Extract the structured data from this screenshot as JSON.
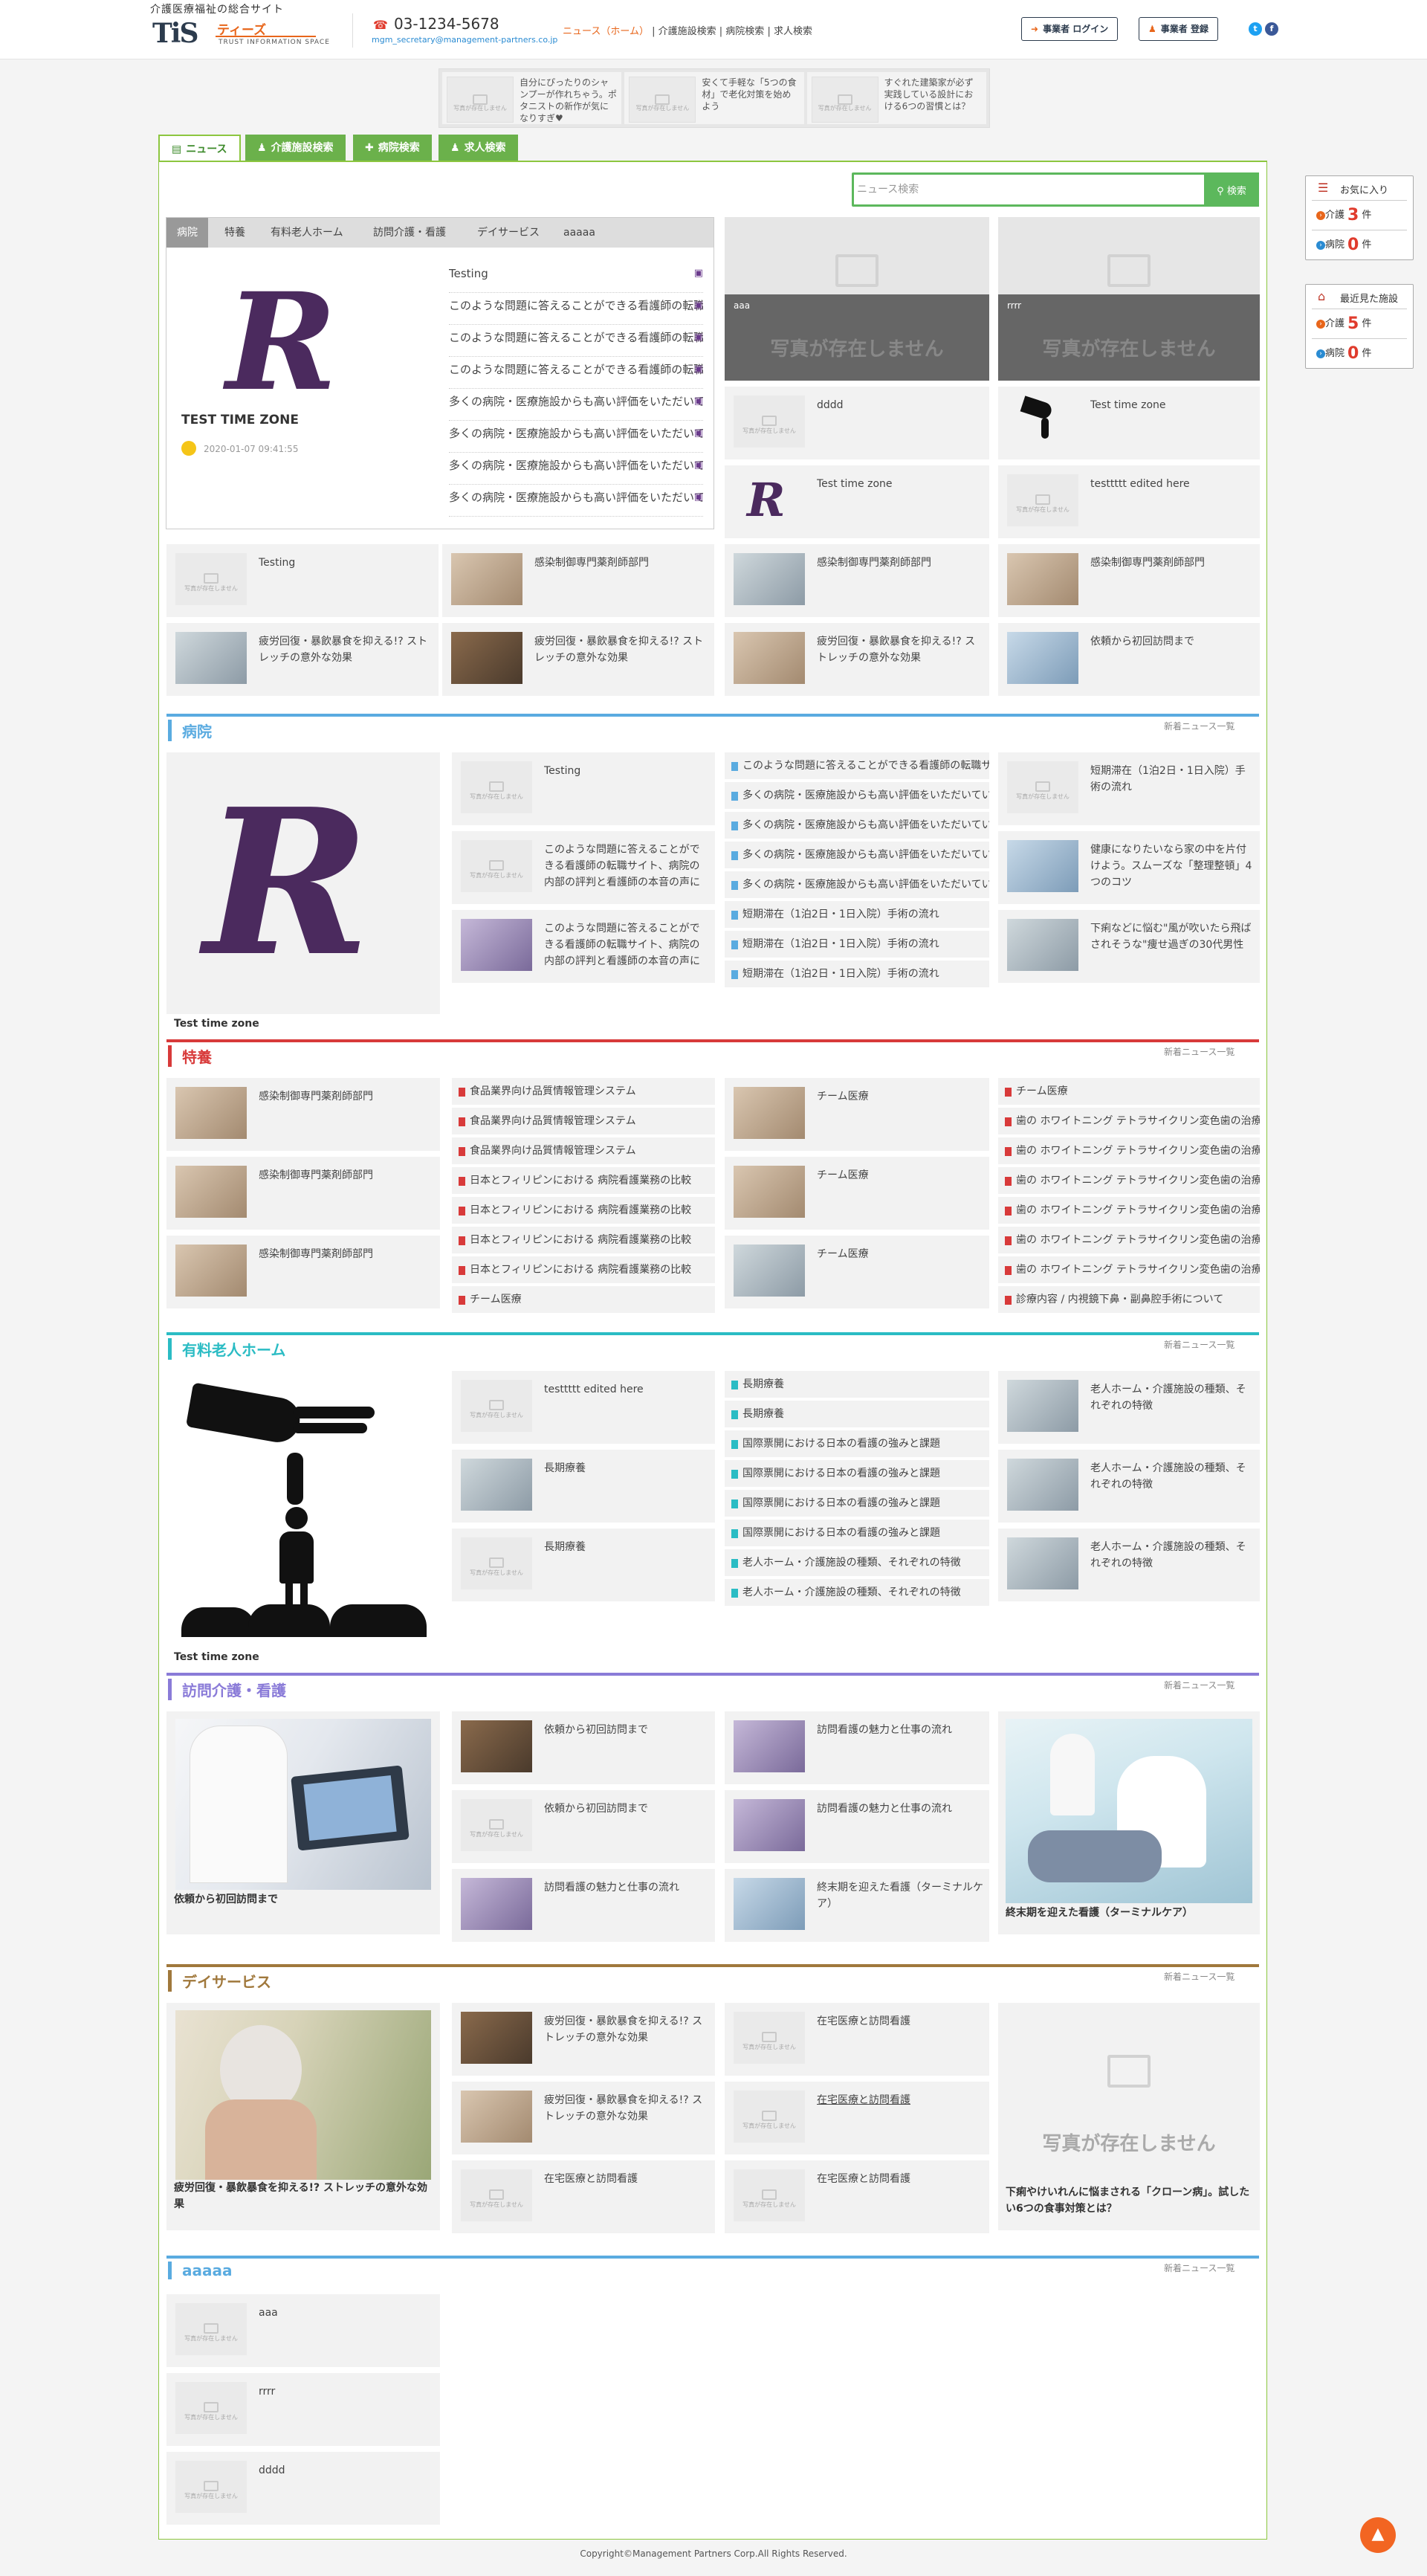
{
  "header": {
    "tagline": "介護医療福祉の総合サイト",
    "logo_mark": "TiS",
    "logo_name": "ティーズ",
    "logo_sub": "TRUST INFORMATION SPACE",
    "phone": "03-1234-5678",
    "email": "mgm_secretary@management-partners.co.jp",
    "nav": [
      "ニュース（ホーム）",
      "介護施設検索",
      "病院検索",
      "求人検索"
    ],
    "login_button": "事業者 ログイン",
    "register_button": "事業者 登録",
    "social": [
      "twitter-icon",
      "facebook-icon"
    ]
  },
  "ads": [
    {
      "text": "自分にぴったりのシャンプーが作れちゃう。ポタニストの新作が気になりすぎ♥"
    },
    {
      "text": "安くて手軽な「5つの食材」で老化対策を始めよう"
    },
    {
      "text": "すぐれた建築家が必ず実践している設計における6つの習慣とは？"
    }
  ],
  "placeholder_caption": "写真が存在しません",
  "tabs": [
    "ニュース",
    "介護施設検索",
    "病院検索",
    "求人検索"
  ],
  "search": {
    "placeholder": "ニュース検索",
    "button": "検索"
  },
  "side": {
    "favorites": {
      "title": "お気に入り",
      "rows": [
        {
          "label": "介護",
          "count": "3",
          "unit": "件"
        },
        {
          "label": "病院",
          "count": "0",
          "unit": "件"
        }
      ]
    },
    "recent": {
      "title": "最近見た施設",
      "rows": [
        {
          "label": "介護",
          "count": "5",
          "unit": "件"
        },
        {
          "label": "病院",
          "count": "0",
          "unit": "件"
        }
      ]
    }
  },
  "feature": {
    "tabs": [
      "病院",
      "特養",
      "有料老人ホーム",
      "訪問介護・看護",
      "デイサービス",
      "aaaaa"
    ],
    "logo": "R",
    "title": "TEST TIME ZONE",
    "date": "2020-01-07 09:41:55",
    "list": [
      "Testing",
      "このような問題に答えることができる看護師の転職サイト",
      "このような問題に答えることができる看護師の転職サイト",
      "このような問題に答えることができる看護師の転職サイト",
      "多くの病院・医療施設からも高い評価をいただいています",
      "多くの病院・医療施設からも高い評価をいただいています",
      "多くの病院・医療施設からも高い評価をいただいています",
      "多くの病院・医療施設からも高い評価をいただいています"
    ]
  },
  "top_right": {
    "big": [
      {
        "label": "aaa",
        "nophoto": "写真が存在しません"
      },
      {
        "label": "rrrr",
        "nophoto": "写真が存在しません"
      }
    ],
    "cards": [
      "dddd",
      "Test time zone",
      "Test time zone",
      "testtttt edited here"
    ]
  },
  "top_grid": [
    "Testing",
    "感染制御専門薬剤師部門",
    "感染制御専門薬剤師部門",
    "感染制御専門薬剤師部門",
    "疲労回復・暴飲暴食を抑える!? ストレッチの意外な効果",
    "疲労回復・暴飲暴食を抑える!? ストレッチの意外な効果",
    "疲労回復・暴飲暴食を抑える!? ストレッチの意外な効果",
    "依頼から初回訪問まで"
  ],
  "more_label": "新着ニュース一覧",
  "sec_hospital": {
    "title": "病院",
    "feature_caption": "Test time zone",
    "cards": [
      "Testing",
      "このような問題に答えることができる看護師の転職サイト、病院の内部の評判と看護師の本音の声に",
      "このような問題に答えることができる看護師の転職サイト、病院の内部の評判と看護師の本音の声に"
    ],
    "list": [
      "このような問題に答えることができる看護師の転職サイト",
      "多くの病院・医療施設からも高い評価をいただいています",
      "多くの病院・医療施設からも高い評価をいただいています",
      "多くの病院・医療施設からも高い評価をいただいています",
      "多くの病院・医療施設からも高い評価をいただいています",
      "短期滞在（1泊2日・1日入院）手術の流れ",
      "短期滞在（1泊2日・1日入院）手術の流れ",
      "短期滞在（1泊2日・1日入院）手術の流れ"
    ],
    "right_cards": [
      "短期滞在（1泊2日・1日入院）手術の流れ",
      "健康になりたいなら家の中を片付けよう。スムーズな「整理整頓」4つのコツ",
      "下痢などに悩む\"風が吹いたら飛ばされそうな\"痩せ過ぎの30代男性"
    ]
  },
  "sec_tokuyou": {
    "title": "特養",
    "cards": [
      "感染制御専門薬剤師部門",
      "感染制御専門薬剤師部門",
      "感染制御専門薬剤師部門"
    ],
    "list": [
      "食品業界向け品質情報管理システム",
      "食品業界向け品質情報管理システム",
      "食品業界向け品質情報管理システム",
      "日本とフィリピンにおける 病院看護業務の比較",
      "日本とフィリピンにおける 病院看護業務の比較",
      "日本とフィリピンにおける 病院看護業務の比較",
      "日本とフィリピンにおける 病院看護業務の比較",
      "チーム医療"
    ],
    "cards2": [
      "チーム医療",
      "チーム医療",
      "チーム医療"
    ],
    "list2": [
      "チーム医療",
      "歯の ホワイトニング テトラサイクリン変色歯の治療",
      "歯の ホワイトニング テトラサイクリン変色歯の治療",
      "歯の ホワイトニング テトラサイクリン変色歯の治療",
      "歯の ホワイトニング テトラサイクリン変色歯の治療",
      "歯の ホワイトニング テトラサイクリン変色歯の治療",
      "歯の ホワイトニング テトラサイクリン変色歯の治療",
      "診療内容 / 内視鏡下鼻・副鼻腔手術について"
    ]
  },
  "sec_yuryo": {
    "title": "有料老人ホーム",
    "feature_caption": "Test time zone",
    "cards": [
      "testtttt edited here",
      "長期療養",
      "長期療養"
    ],
    "list": [
      "長期療養",
      "長期療養",
      "国際票開における日本の看護の強みと課題",
      "国際票開における日本の看護の強みと課題",
      "国際票開における日本の看護の強みと課題",
      "国際票開における日本の看護の強みと課題",
      "老人ホーム・介護施設の種類、それぞれの特徴",
      "老人ホーム・介護施設の種類、それぞれの特徴"
    ],
    "right_cards": [
      "老人ホーム・介護施設の種類、それぞれの特徴",
      "老人ホーム・介護施設の種類、それぞれの特徴",
      "老人ホーム・介護施設の種類、それぞれの特徴"
    ]
  },
  "sec_houmon": {
    "title": "訪問介護・看護",
    "feature_caption": "依頼から初回訪問まで",
    "cards": [
      "依頼から初回訪問まで",
      "依頼から初回訪問まで",
      "訪問看護の魅力と仕事の流れ"
    ],
    "cards2": [
      "訪問看護の魅力と仕事の流れ",
      "訪問看護の魅力と仕事の流れ",
      "終末期を迎えた看護（ターミナルケア）"
    ],
    "right_caption": "終末期を迎えた看護（ターミナルケア）"
  },
  "sec_day": {
    "title": "デイサービス",
    "feature_caption": "疲労回復・暴飲暴食を抑える!? ストレッチの意外な効果",
    "cards": [
      "疲労回復・暴飲暴食を抑える!? ストレッチの意外な効果",
      "疲労回復・暴飲暴食を抑える!? ストレッチの意外な効果",
      "在宅医療と訪問看護"
    ],
    "cards2": [
      "在宅医療と訪問看護",
      "在宅医療と訪問看護",
      "在宅医療と訪問看護"
    ],
    "right_caption": "下痢やけいれんに悩まされる「クローン病」。試したい6つの食事対策とは？",
    "right_nophoto": "写真が存在しません"
  },
  "sec_a": {
    "title": "aaaaa",
    "cards": [
      "aaa",
      "rrrr",
      "dddd"
    ]
  },
  "footer": {
    "copyright": "Copyright©Management Partners Corp.All Rights Reserved."
  },
  "colors": {
    "green": "#6bb14b",
    "hospital": "#5aabe0",
    "tokuyou": "#d83a3a",
    "yuryo": "#2bbcc4",
    "houmon": "#8a7bd8",
    "day": "#a0783c",
    "aaaaa": "#5aabe0",
    "accent": "#e8661b"
  }
}
